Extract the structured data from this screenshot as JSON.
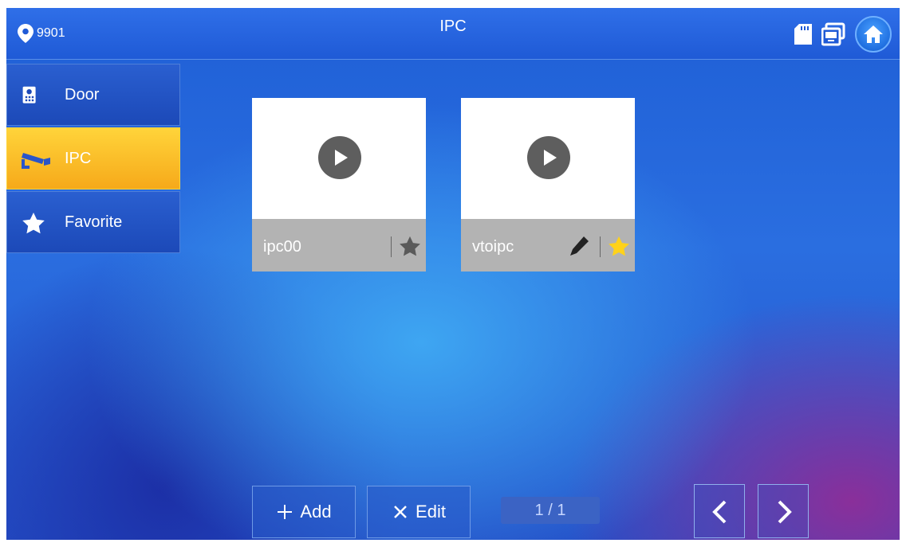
{
  "header": {
    "location_id": "9901",
    "title": "IPC",
    "icons": [
      "location-pin-icon",
      "sd-card-icon",
      "monitor-icon",
      "home-icon"
    ]
  },
  "sidebar": {
    "items": [
      {
        "label": "Door",
        "icon": "door-station-icon",
        "active": false
      },
      {
        "label": "IPC",
        "icon": "camera-icon",
        "active": true
      },
      {
        "label": "Favorite",
        "icon": "star-icon",
        "active": false
      }
    ]
  },
  "cameras": [
    {
      "name": "ipc00",
      "favorite": false,
      "editable": false
    },
    {
      "name": "vtoipc",
      "favorite": true,
      "editable": true
    }
  ],
  "toolbar": {
    "add_label": "Add",
    "edit_label": "Edit",
    "page_indicator": "1 / 1"
  },
  "colors": {
    "active_tab": "#ffc62a",
    "favorite_star": "#ffd21a",
    "inactive_star": "#5a5a5a"
  }
}
